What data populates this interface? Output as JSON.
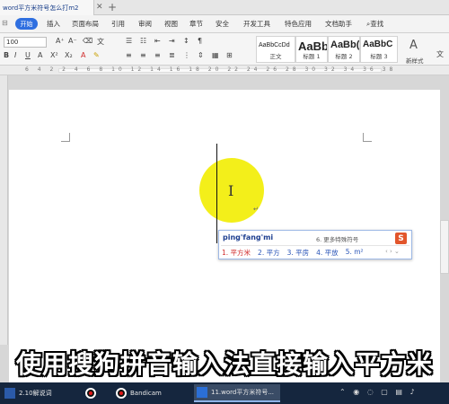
{
  "window": {
    "doc_tab_label": "word平方米符号怎么打m2",
    "close_glyph": "✕",
    "add_glyph": "+"
  },
  "menu": {
    "start": "开始",
    "items": [
      "插入",
      "页面布局",
      "引用",
      "审阅",
      "视图",
      "章节",
      "安全",
      "开发工具",
      "特色应用",
      "文档助手",
      "查找"
    ]
  },
  "toolbar": {
    "font_size": "100",
    "styles": [
      {
        "sample": "AaBbCcDd",
        "name": "正文"
      },
      {
        "sample": "AaBb",
        "name": "标题 1"
      },
      {
        "sample": "AaBb(",
        "name": "标题 2"
      },
      {
        "sample": "AaBbC",
        "name": "标题 3"
      }
    ],
    "new_style": "新样式",
    "a_label": "文"
  },
  "ruler": {
    "text": "6 4 2 2 4 6 8 10 12 14 16 18 20 22 24 26 28 30 32 34 36 38"
  },
  "ime": {
    "input": "ping'fang'mi",
    "tip": "6. 更多特殊符号",
    "logo": "S",
    "candidates": [
      "1. 平方米",
      "2. 平方",
      "3. 平房",
      "4. 平放",
      "5. m²"
    ],
    "arrows": "‹ › ⌄"
  },
  "caption": "使用搜狗拼音输入法直接输入平方米",
  "taskbar": {
    "tasks": [
      {
        "label": "2.10解说词",
        "color": "#2b5aa8"
      },
      {
        "label": "",
        "color": "#000000"
      },
      {
        "label": "Bandicam",
        "color": "#000000"
      },
      {
        "label": "11.word平方米符号...",
        "color": "#2b6fd6"
      }
    ],
    "tray": "⌃ ◉ ◌ ▢ ▤ ♪"
  }
}
